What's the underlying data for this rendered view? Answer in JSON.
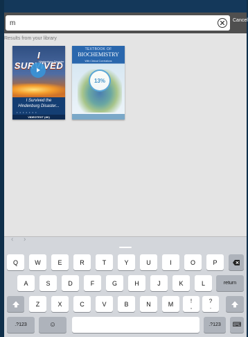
{
  "search": {
    "value": "m"
  },
  "header": {
    "cancel_label": "Cancel"
  },
  "results": {
    "section_label": "Results from your library",
    "books": [
      {
        "cover_title": "I SURVIVED",
        "cover_subtitle": "Hindenburg Disaster",
        "caption_line1": "I Survived the",
        "caption_line2": "Hindenburg Disaster...",
        "footer": "VIDEOTEXT (4K)"
      },
      {
        "cover_top": "TEXTBOOK OF",
        "cover_title": "BIOCHEMISTRY",
        "cover_subtitle": "With Clinical Correlations",
        "progress": "13%"
      }
    ]
  },
  "keyboard": {
    "row1": [
      "Q",
      "W",
      "E",
      "R",
      "T",
      "Y",
      "U",
      "I",
      "O",
      "P"
    ],
    "row2": [
      "A",
      "S",
      "D",
      "F",
      "G",
      "H",
      "J",
      "K",
      "L"
    ],
    "row3": [
      "Z",
      "X",
      "C",
      "V",
      "B",
      "N",
      "M",
      "!",
      ",",
      "?",
      "."
    ],
    "return_label": "return",
    "numbers_label": ".?123",
    "emoji_label": "☺",
    "keyboard_icon_label": "⌨"
  },
  "colors": {
    "status": "#14385a",
    "topbar": "#4f4f4f",
    "accent": "#5aa7d8"
  }
}
